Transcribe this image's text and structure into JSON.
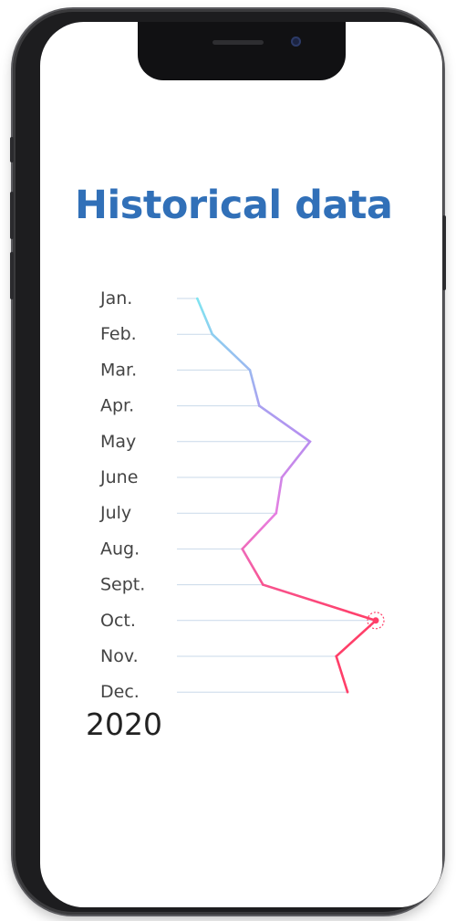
{
  "screen": {
    "title": "Historical data",
    "year": "2020"
  },
  "chart_data": {
    "type": "line",
    "orientation": "vertical",
    "title": "Historical data",
    "categories": [
      "Jan.",
      "Feb.",
      "Mar.",
      "Apr.",
      "May",
      "June",
      "July",
      "Aug.",
      "Sept.",
      "Oct.",
      "Nov.",
      "Dec."
    ],
    "values": [
      5,
      13,
      33,
      38,
      65,
      50,
      47,
      29,
      40,
      100,
      79,
      85
    ],
    "value_range": [
      0,
      100
    ],
    "highlighted_category": "Oct.",
    "gridlines": true,
    "colors": {
      "gradient": [
        "#7fe6f0",
        "#b58ff0",
        "#e77ee0",
        "#ff3f69"
      ],
      "highlight": "#ff3f69",
      "gridline": "#c9d9ea"
    }
  }
}
